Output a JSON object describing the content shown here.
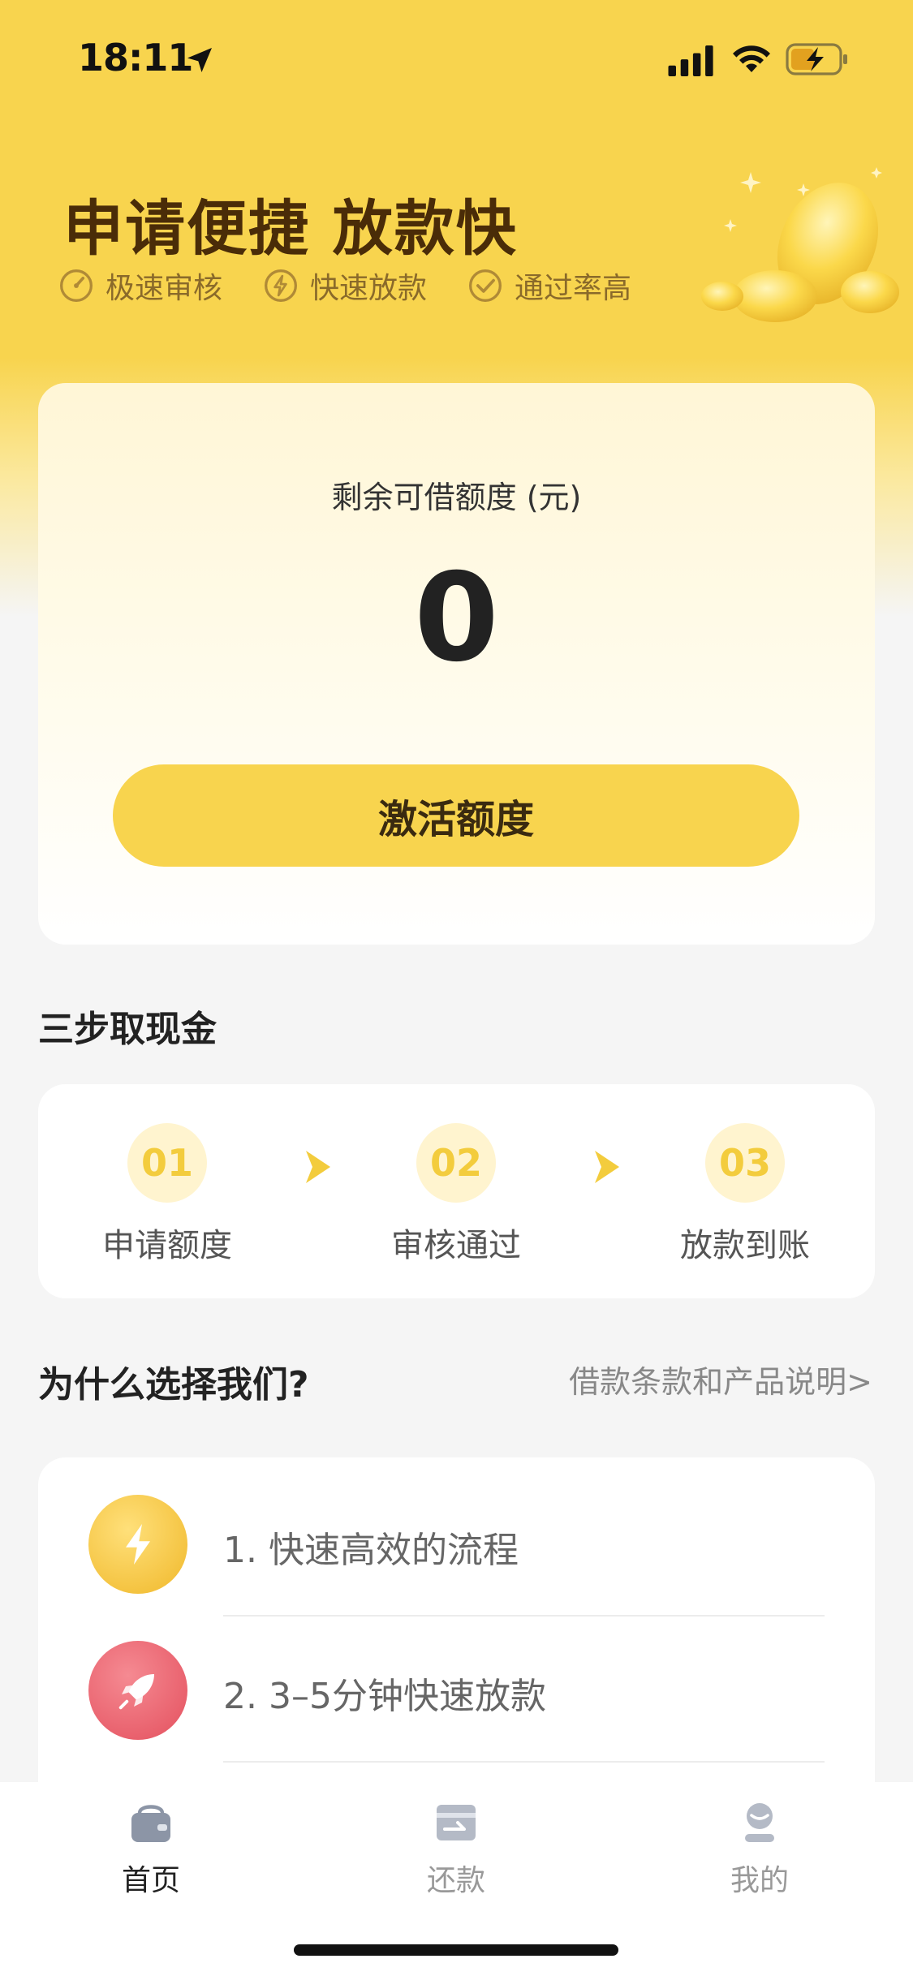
{
  "status_bar": {
    "time": "18:11"
  },
  "hero": {
    "title": "申请便捷 放款快",
    "features": [
      "极速审核",
      "快速放款",
      "通过率高"
    ]
  },
  "credit": {
    "label": "剩余可借额度 (元)",
    "amount": "0",
    "activate_label": "激活额度"
  },
  "steps": {
    "title": "三步取现金",
    "items": [
      {
        "num": "01",
        "label": "申请额度"
      },
      {
        "num": "02",
        "label": "审核通过"
      },
      {
        "num": "03",
        "label": "放款到账"
      }
    ]
  },
  "why": {
    "title": "为什么选择我们?",
    "terms_link": "借款条款和产品说明>",
    "items": [
      {
        "text": "1. 快速高效的流程",
        "icon": "lightning-icon",
        "color": "#f3c53a"
      },
      {
        "text": "2. 3–5分钟快速放款",
        "icon": "rocket-icon",
        "color": "#ee6b76"
      }
    ]
  },
  "tabs": [
    {
      "label": "首页",
      "icon": "wallet-icon",
      "active": true
    },
    {
      "label": "还款",
      "icon": "repay-card-icon",
      "active": false
    },
    {
      "label": "我的",
      "icon": "user-icon",
      "active": false
    }
  ],
  "colors": {
    "brand_yellow": "#f8d44e",
    "text_dark": "#4a2c08",
    "accent_red": "#ee6b76"
  }
}
